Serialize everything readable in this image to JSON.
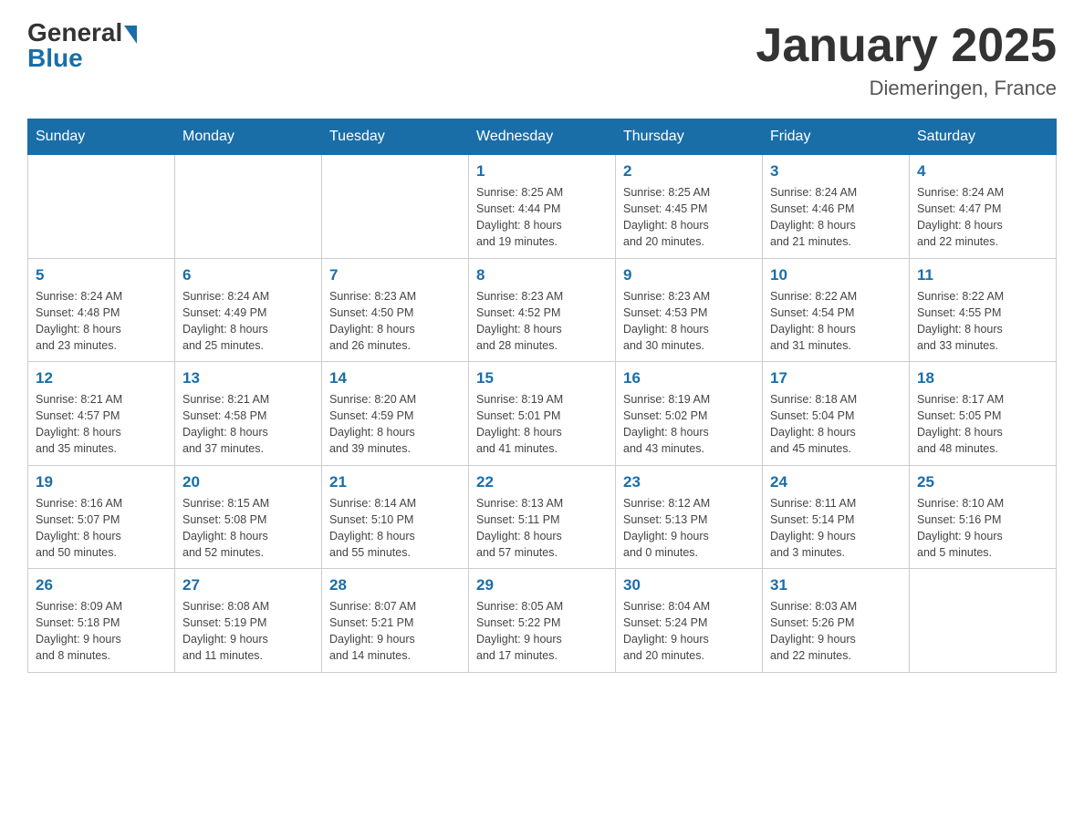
{
  "header": {
    "logo_general": "General",
    "logo_blue": "Blue",
    "title": "January 2025",
    "subtitle": "Diemeringen, France"
  },
  "weekdays": [
    "Sunday",
    "Monday",
    "Tuesday",
    "Wednesday",
    "Thursday",
    "Friday",
    "Saturday"
  ],
  "weeks": [
    [
      {
        "day": "",
        "info": ""
      },
      {
        "day": "",
        "info": ""
      },
      {
        "day": "",
        "info": ""
      },
      {
        "day": "1",
        "info": "Sunrise: 8:25 AM\nSunset: 4:44 PM\nDaylight: 8 hours\nand 19 minutes."
      },
      {
        "day": "2",
        "info": "Sunrise: 8:25 AM\nSunset: 4:45 PM\nDaylight: 8 hours\nand 20 minutes."
      },
      {
        "day": "3",
        "info": "Sunrise: 8:24 AM\nSunset: 4:46 PM\nDaylight: 8 hours\nand 21 minutes."
      },
      {
        "day": "4",
        "info": "Sunrise: 8:24 AM\nSunset: 4:47 PM\nDaylight: 8 hours\nand 22 minutes."
      }
    ],
    [
      {
        "day": "5",
        "info": "Sunrise: 8:24 AM\nSunset: 4:48 PM\nDaylight: 8 hours\nand 23 minutes."
      },
      {
        "day": "6",
        "info": "Sunrise: 8:24 AM\nSunset: 4:49 PM\nDaylight: 8 hours\nand 25 minutes."
      },
      {
        "day": "7",
        "info": "Sunrise: 8:23 AM\nSunset: 4:50 PM\nDaylight: 8 hours\nand 26 minutes."
      },
      {
        "day": "8",
        "info": "Sunrise: 8:23 AM\nSunset: 4:52 PM\nDaylight: 8 hours\nand 28 minutes."
      },
      {
        "day": "9",
        "info": "Sunrise: 8:23 AM\nSunset: 4:53 PM\nDaylight: 8 hours\nand 30 minutes."
      },
      {
        "day": "10",
        "info": "Sunrise: 8:22 AM\nSunset: 4:54 PM\nDaylight: 8 hours\nand 31 minutes."
      },
      {
        "day": "11",
        "info": "Sunrise: 8:22 AM\nSunset: 4:55 PM\nDaylight: 8 hours\nand 33 minutes."
      }
    ],
    [
      {
        "day": "12",
        "info": "Sunrise: 8:21 AM\nSunset: 4:57 PM\nDaylight: 8 hours\nand 35 minutes."
      },
      {
        "day": "13",
        "info": "Sunrise: 8:21 AM\nSunset: 4:58 PM\nDaylight: 8 hours\nand 37 minutes."
      },
      {
        "day": "14",
        "info": "Sunrise: 8:20 AM\nSunset: 4:59 PM\nDaylight: 8 hours\nand 39 minutes."
      },
      {
        "day": "15",
        "info": "Sunrise: 8:19 AM\nSunset: 5:01 PM\nDaylight: 8 hours\nand 41 minutes."
      },
      {
        "day": "16",
        "info": "Sunrise: 8:19 AM\nSunset: 5:02 PM\nDaylight: 8 hours\nand 43 minutes."
      },
      {
        "day": "17",
        "info": "Sunrise: 8:18 AM\nSunset: 5:04 PM\nDaylight: 8 hours\nand 45 minutes."
      },
      {
        "day": "18",
        "info": "Sunrise: 8:17 AM\nSunset: 5:05 PM\nDaylight: 8 hours\nand 48 minutes."
      }
    ],
    [
      {
        "day": "19",
        "info": "Sunrise: 8:16 AM\nSunset: 5:07 PM\nDaylight: 8 hours\nand 50 minutes."
      },
      {
        "day": "20",
        "info": "Sunrise: 8:15 AM\nSunset: 5:08 PM\nDaylight: 8 hours\nand 52 minutes."
      },
      {
        "day": "21",
        "info": "Sunrise: 8:14 AM\nSunset: 5:10 PM\nDaylight: 8 hours\nand 55 minutes."
      },
      {
        "day": "22",
        "info": "Sunrise: 8:13 AM\nSunset: 5:11 PM\nDaylight: 8 hours\nand 57 minutes."
      },
      {
        "day": "23",
        "info": "Sunrise: 8:12 AM\nSunset: 5:13 PM\nDaylight: 9 hours\nand 0 minutes."
      },
      {
        "day": "24",
        "info": "Sunrise: 8:11 AM\nSunset: 5:14 PM\nDaylight: 9 hours\nand 3 minutes."
      },
      {
        "day": "25",
        "info": "Sunrise: 8:10 AM\nSunset: 5:16 PM\nDaylight: 9 hours\nand 5 minutes."
      }
    ],
    [
      {
        "day": "26",
        "info": "Sunrise: 8:09 AM\nSunset: 5:18 PM\nDaylight: 9 hours\nand 8 minutes."
      },
      {
        "day": "27",
        "info": "Sunrise: 8:08 AM\nSunset: 5:19 PM\nDaylight: 9 hours\nand 11 minutes."
      },
      {
        "day": "28",
        "info": "Sunrise: 8:07 AM\nSunset: 5:21 PM\nDaylight: 9 hours\nand 14 minutes."
      },
      {
        "day": "29",
        "info": "Sunrise: 8:05 AM\nSunset: 5:22 PM\nDaylight: 9 hours\nand 17 minutes."
      },
      {
        "day": "30",
        "info": "Sunrise: 8:04 AM\nSunset: 5:24 PM\nDaylight: 9 hours\nand 20 minutes."
      },
      {
        "day": "31",
        "info": "Sunrise: 8:03 AM\nSunset: 5:26 PM\nDaylight: 9 hours\nand 22 minutes."
      },
      {
        "day": "",
        "info": ""
      }
    ]
  ]
}
